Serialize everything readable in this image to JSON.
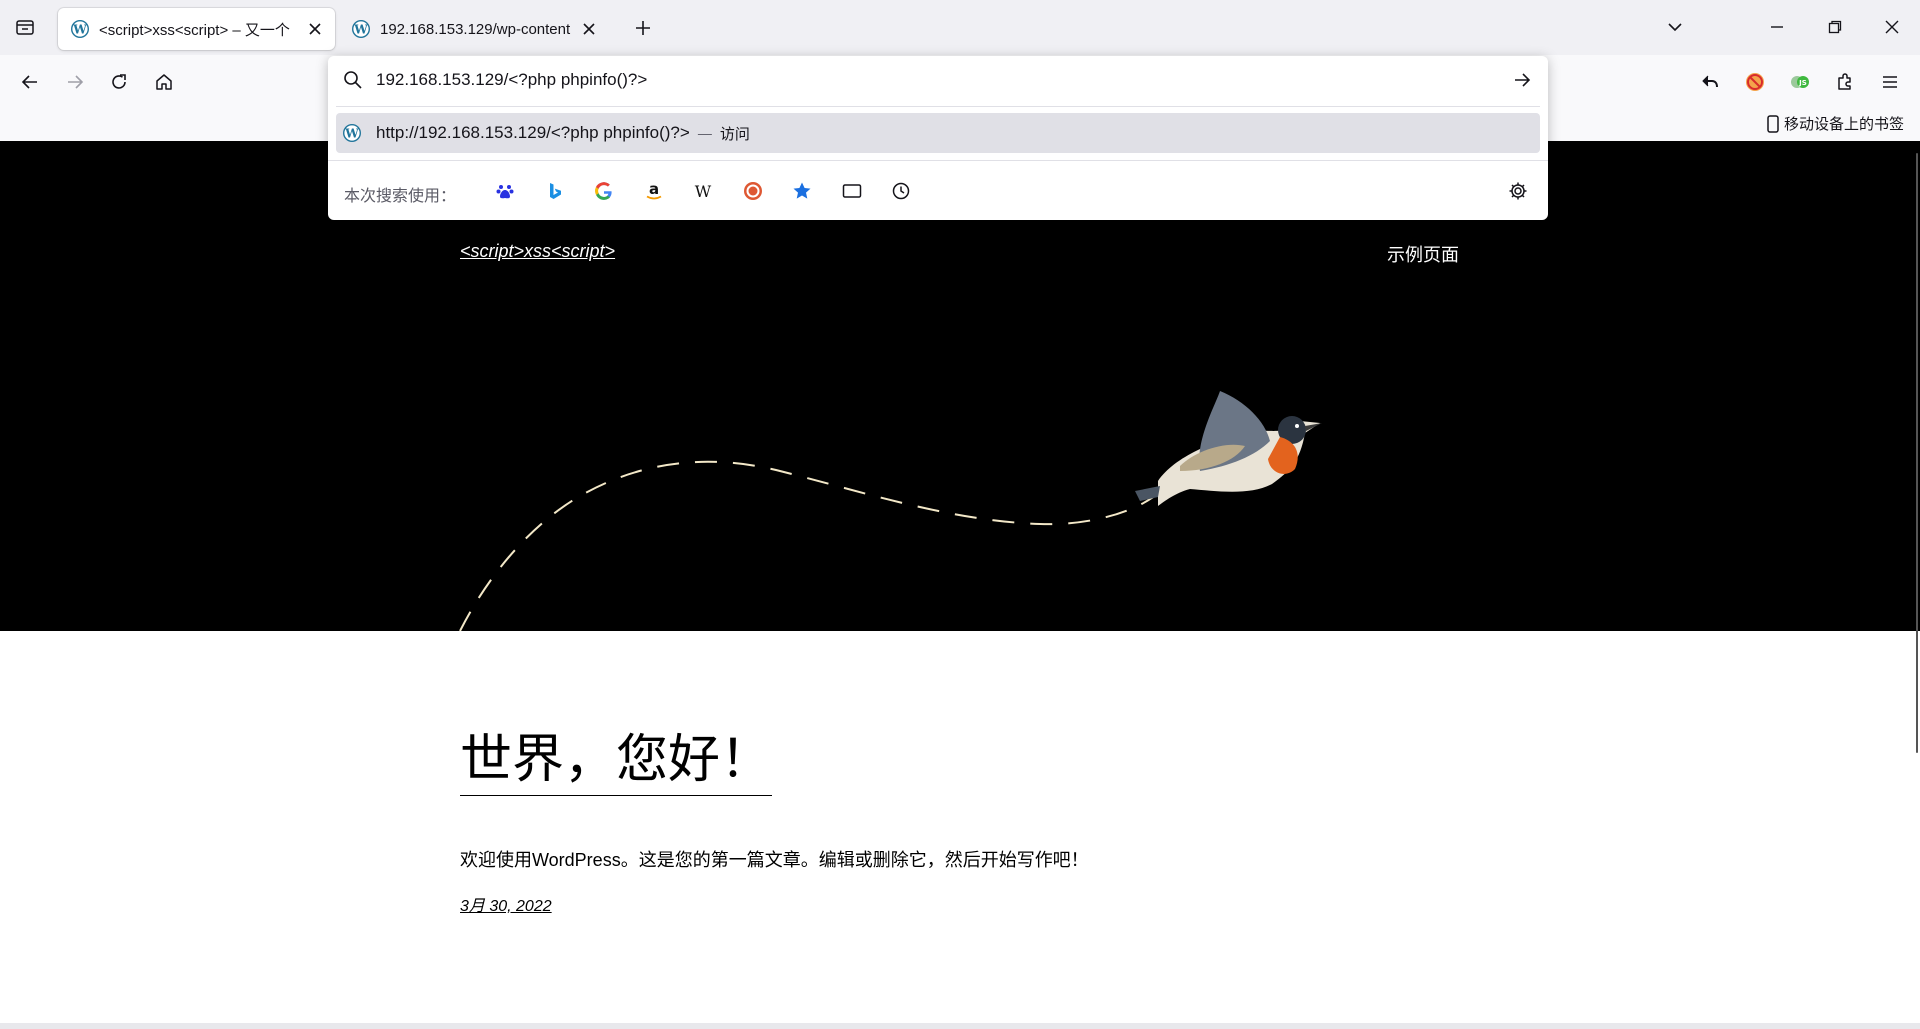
{
  "browser": {
    "tabs": [
      {
        "title": "<script>xss<script> – 又一个",
        "active": true
      },
      {
        "title": "192.168.153.129/wp-content",
        "active": false
      }
    ],
    "address": {
      "value": "192.168.153.129/<?php phpinfo()?>"
    },
    "suggestion": {
      "url": "http://192.168.153.129/<?php phpinfo()?>",
      "separator": "—",
      "action": "访问"
    },
    "one_off": {
      "label": "本次搜索使用："
    },
    "bookmarks": {
      "mobile": "移动设备上的书签"
    }
  },
  "site": {
    "title": "<script>xss<script>",
    "nav_item": "示例页面"
  },
  "post": {
    "title": "世界，您好！",
    "excerpt": "欢迎使用WordPress。这是您的第一篇文章。编辑或删除它，然后开始写作吧！",
    "date": "3月 30, 2022"
  },
  "colors": {
    "hero_bg": "#000000",
    "tab_strip": "#f0f0f4",
    "navbar": "#f9f9fb",
    "wp_blue": "#21759b",
    "suggestion_highlight": "#e0e0e6"
  }
}
